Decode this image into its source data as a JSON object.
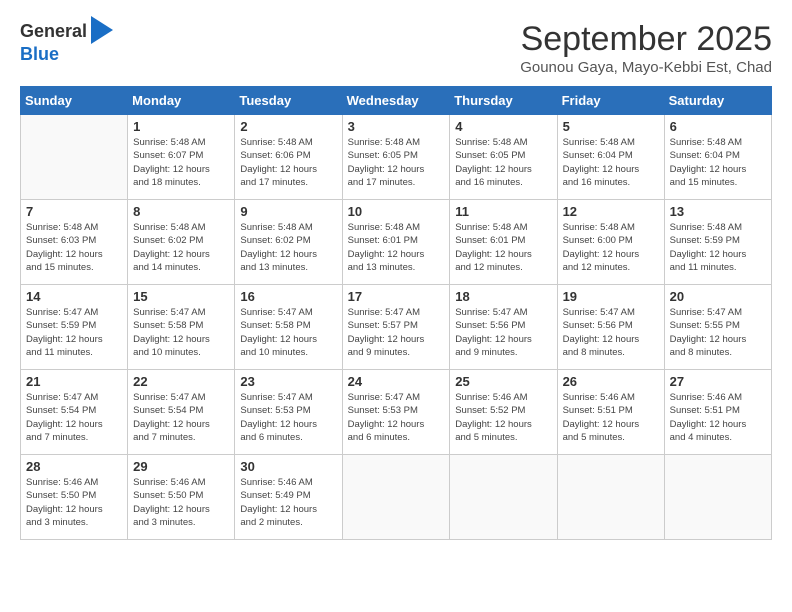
{
  "header": {
    "logo_line1": "General",
    "logo_line2": "Blue",
    "month_title": "September 2025",
    "subtitle": "Gounou Gaya, Mayo-Kebbi Est, Chad"
  },
  "days_of_week": [
    "Sunday",
    "Monday",
    "Tuesday",
    "Wednesday",
    "Thursday",
    "Friday",
    "Saturday"
  ],
  "weeks": [
    [
      {
        "day": "",
        "info": ""
      },
      {
        "day": "1",
        "info": "Sunrise: 5:48 AM\nSunset: 6:07 PM\nDaylight: 12 hours\nand 18 minutes."
      },
      {
        "day": "2",
        "info": "Sunrise: 5:48 AM\nSunset: 6:06 PM\nDaylight: 12 hours\nand 17 minutes."
      },
      {
        "day": "3",
        "info": "Sunrise: 5:48 AM\nSunset: 6:05 PM\nDaylight: 12 hours\nand 17 minutes."
      },
      {
        "day": "4",
        "info": "Sunrise: 5:48 AM\nSunset: 6:05 PM\nDaylight: 12 hours\nand 16 minutes."
      },
      {
        "day": "5",
        "info": "Sunrise: 5:48 AM\nSunset: 6:04 PM\nDaylight: 12 hours\nand 16 minutes."
      },
      {
        "day": "6",
        "info": "Sunrise: 5:48 AM\nSunset: 6:04 PM\nDaylight: 12 hours\nand 15 minutes."
      }
    ],
    [
      {
        "day": "7",
        "info": "Sunrise: 5:48 AM\nSunset: 6:03 PM\nDaylight: 12 hours\nand 15 minutes."
      },
      {
        "day": "8",
        "info": "Sunrise: 5:48 AM\nSunset: 6:02 PM\nDaylight: 12 hours\nand 14 minutes."
      },
      {
        "day": "9",
        "info": "Sunrise: 5:48 AM\nSunset: 6:02 PM\nDaylight: 12 hours\nand 13 minutes."
      },
      {
        "day": "10",
        "info": "Sunrise: 5:48 AM\nSunset: 6:01 PM\nDaylight: 12 hours\nand 13 minutes."
      },
      {
        "day": "11",
        "info": "Sunrise: 5:48 AM\nSunset: 6:01 PM\nDaylight: 12 hours\nand 12 minutes."
      },
      {
        "day": "12",
        "info": "Sunrise: 5:48 AM\nSunset: 6:00 PM\nDaylight: 12 hours\nand 12 minutes."
      },
      {
        "day": "13",
        "info": "Sunrise: 5:48 AM\nSunset: 5:59 PM\nDaylight: 12 hours\nand 11 minutes."
      }
    ],
    [
      {
        "day": "14",
        "info": "Sunrise: 5:47 AM\nSunset: 5:59 PM\nDaylight: 12 hours\nand 11 minutes."
      },
      {
        "day": "15",
        "info": "Sunrise: 5:47 AM\nSunset: 5:58 PM\nDaylight: 12 hours\nand 10 minutes."
      },
      {
        "day": "16",
        "info": "Sunrise: 5:47 AM\nSunset: 5:58 PM\nDaylight: 12 hours\nand 10 minutes."
      },
      {
        "day": "17",
        "info": "Sunrise: 5:47 AM\nSunset: 5:57 PM\nDaylight: 12 hours\nand 9 minutes."
      },
      {
        "day": "18",
        "info": "Sunrise: 5:47 AM\nSunset: 5:56 PM\nDaylight: 12 hours\nand 9 minutes."
      },
      {
        "day": "19",
        "info": "Sunrise: 5:47 AM\nSunset: 5:56 PM\nDaylight: 12 hours\nand 8 minutes."
      },
      {
        "day": "20",
        "info": "Sunrise: 5:47 AM\nSunset: 5:55 PM\nDaylight: 12 hours\nand 8 minutes."
      }
    ],
    [
      {
        "day": "21",
        "info": "Sunrise: 5:47 AM\nSunset: 5:54 PM\nDaylight: 12 hours\nand 7 minutes."
      },
      {
        "day": "22",
        "info": "Sunrise: 5:47 AM\nSunset: 5:54 PM\nDaylight: 12 hours\nand 7 minutes."
      },
      {
        "day": "23",
        "info": "Sunrise: 5:47 AM\nSunset: 5:53 PM\nDaylight: 12 hours\nand 6 minutes."
      },
      {
        "day": "24",
        "info": "Sunrise: 5:47 AM\nSunset: 5:53 PM\nDaylight: 12 hours\nand 6 minutes."
      },
      {
        "day": "25",
        "info": "Sunrise: 5:46 AM\nSunset: 5:52 PM\nDaylight: 12 hours\nand 5 minutes."
      },
      {
        "day": "26",
        "info": "Sunrise: 5:46 AM\nSunset: 5:51 PM\nDaylight: 12 hours\nand 5 minutes."
      },
      {
        "day": "27",
        "info": "Sunrise: 5:46 AM\nSunset: 5:51 PM\nDaylight: 12 hours\nand 4 minutes."
      }
    ],
    [
      {
        "day": "28",
        "info": "Sunrise: 5:46 AM\nSunset: 5:50 PM\nDaylight: 12 hours\nand 3 minutes."
      },
      {
        "day": "29",
        "info": "Sunrise: 5:46 AM\nSunset: 5:50 PM\nDaylight: 12 hours\nand 3 minutes."
      },
      {
        "day": "30",
        "info": "Sunrise: 5:46 AM\nSunset: 5:49 PM\nDaylight: 12 hours\nand 2 minutes."
      },
      {
        "day": "",
        "info": ""
      },
      {
        "day": "",
        "info": ""
      },
      {
        "day": "",
        "info": ""
      },
      {
        "day": "",
        "info": ""
      }
    ]
  ]
}
